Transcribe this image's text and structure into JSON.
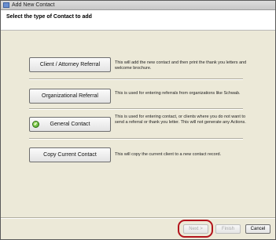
{
  "window": {
    "title": "Add New Contact"
  },
  "header": {
    "text": "Select the type of Contact to add"
  },
  "options": [
    {
      "label": "Client / Attorney Referral",
      "description": "This will add the new contact and then print the thank you letters and welcome brochure."
    },
    {
      "label": "Organizational Referral",
      "description": "This is used for entering referrals from organizations like Schwab."
    },
    {
      "label": "General Contact",
      "description": "This is used for entering contact, or clients where you do not want to send a referral or thank you letter. This will not generate any Actions."
    },
    {
      "label": "Copy Current Contact",
      "description": "This will copy the current client to a new contact record."
    }
  ],
  "footer": {
    "next_label": "Next >",
    "finish_label": "Finish",
    "cancel_label": "Cancel"
  },
  "colors": {
    "highlight": "#b3141c",
    "check": "#3f9a1e"
  }
}
